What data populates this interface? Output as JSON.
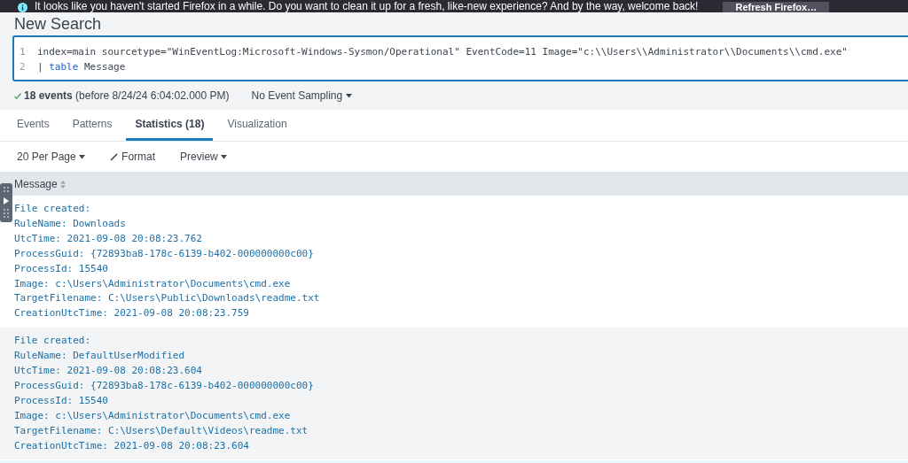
{
  "notification": {
    "message": "It looks like you haven't started Firefox in a while. Do you want to clean it up for a fresh, like-new experience? And by the way, welcome back!",
    "button": "Refresh Firefox…"
  },
  "page_title": "New Search",
  "query": {
    "lines": [
      {
        "number": "1",
        "tokens": [
          {
            "kind": "plain",
            "text": "index=main sourcetype=\"WinEventLog:Microsoft-Windows-Sysmon/Operational\" EventCode=11 Image=\"c:\\\\Users\\\\Administrator\\\\Documents\\\\cmd.exe\""
          }
        ]
      },
      {
        "number": "2",
        "tokens": [
          {
            "kind": "plain",
            "text": "|"
          },
          {
            "kind": "command",
            "text": "table"
          },
          {
            "kind": "plain",
            "text": "Message"
          }
        ]
      }
    ]
  },
  "status": {
    "count": "18 events",
    "range": "(before 8/24/24 6:04:02.000 PM)",
    "sampling": "No Event Sampling"
  },
  "tabs": [
    {
      "label": "Events",
      "selected": false
    },
    {
      "label": "Patterns",
      "selected": false
    },
    {
      "label": "Statistics (18)",
      "selected": true
    },
    {
      "label": "Visualization",
      "selected": false
    }
  ],
  "toolbar": [
    {
      "kind": "dropdown",
      "label": "20 Per Page"
    },
    {
      "kind": "format",
      "label": "Format"
    },
    {
      "kind": "dropdown",
      "label": "Preview"
    }
  ],
  "table": {
    "columns": [
      "Message"
    ],
    "rows": [
      {
        "lines": [
          "File created:",
          "RuleName: Downloads",
          "UtcTime: 2021-09-08 20:08:23.762",
          "ProcessGuid: {72893ba8-178c-6139-b402-000000000c00}",
          "ProcessId: 15540",
          "Image: c:\\Users\\Administrator\\Documents\\cmd.exe",
          "TargetFilename: C:\\Users\\Public\\Downloads\\readme.txt",
          "CreationUtcTime: 2021-09-08 20:08:23.759"
        ]
      },
      {
        "lines": [
          "File created:",
          "RuleName: DefaultUserModified",
          "UtcTime: 2021-09-08 20:08:23.604",
          "ProcessGuid: {72893ba8-178c-6139-b402-000000000c00}",
          "ProcessId: 15540",
          "Image: c:\\Users\\Administrator\\Documents\\cmd.exe",
          "TargetFilename: C:\\Users\\Default\\Videos\\readme.txt",
          "CreationUtcTime: 2021-09-08 20:08:23.604"
        ]
      }
    ]
  }
}
